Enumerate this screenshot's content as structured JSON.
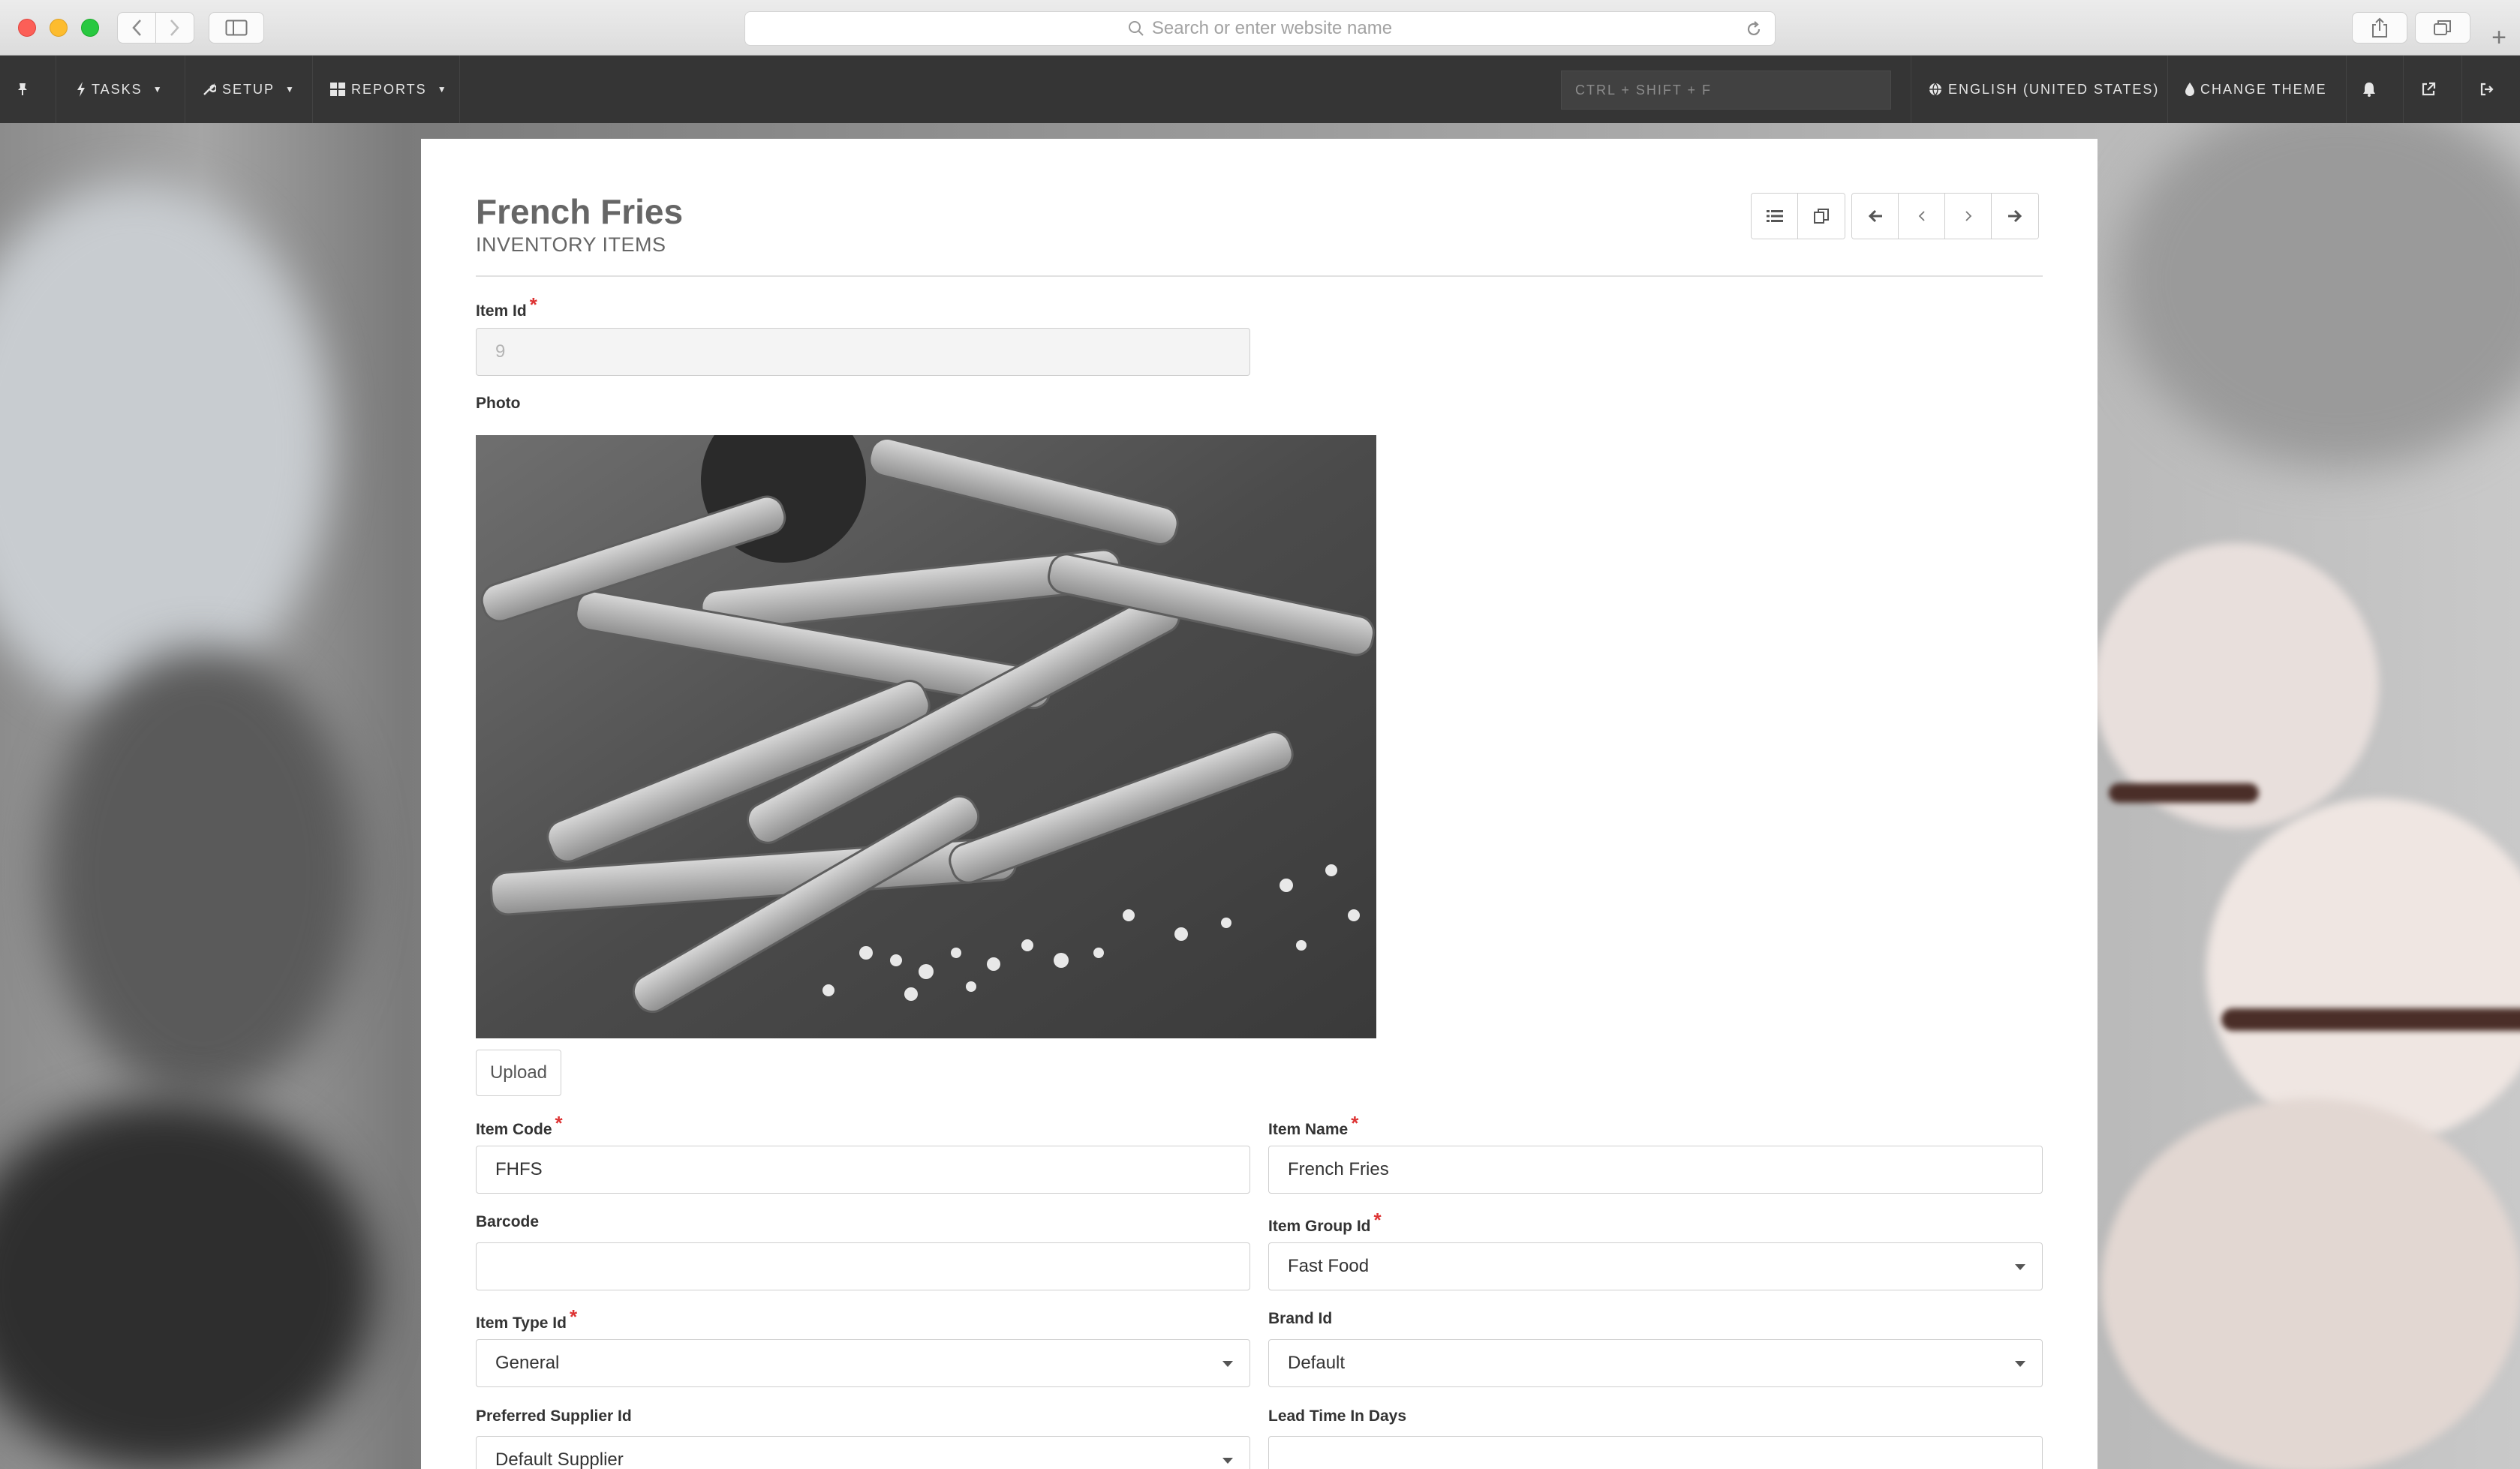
{
  "browser": {
    "address_placeholder": "Search or enter website name",
    "icons": [
      "back-icon",
      "forward-icon",
      "sidebar-icon",
      "search-icon",
      "reload-icon",
      "share-icon",
      "tabs-icon",
      "plus-icon"
    ]
  },
  "navbar": {
    "pin_icon": "pin-icon",
    "tasks": "TASKS",
    "setup": "SETUP",
    "reports": "REPORTS",
    "search_placeholder": "CTRL + SHIFT + F",
    "language": "ENGLISH (UNITED STATES)",
    "change_theme": "CHANGE THEME",
    "icons": [
      "bolt-icon",
      "wrench-icon",
      "grid-icon",
      "globe-icon",
      "droplet-icon",
      "bell-icon",
      "external-link-icon",
      "sign-out-icon"
    ]
  },
  "page": {
    "title": "French Fries",
    "subtitle": "INVENTORY ITEMS",
    "toolbar_icons": [
      "list-icon",
      "copy-icon",
      "arrow-left-icon",
      "chevron-left-icon",
      "chevron-right-icon",
      "arrow-right-icon"
    ]
  },
  "form": {
    "item_id": {
      "label": "Item Id",
      "required": "*",
      "value": "9"
    },
    "photo": {
      "label": "Photo",
      "upload_label": "Upload"
    },
    "item_code": {
      "label": "Item Code",
      "required": "*",
      "value": "FHFS"
    },
    "item_name": {
      "label": "Item Name",
      "required": "*",
      "value": "French Fries"
    },
    "barcode": {
      "label": "Barcode",
      "value": ""
    },
    "item_group_id": {
      "label": "Item Group Id",
      "required": "*",
      "value": "Fast Food"
    },
    "item_type_id": {
      "label": "Item Type Id",
      "required": "*",
      "value": "General"
    },
    "brand_id": {
      "label": "Brand Id",
      "value": "Default"
    },
    "preferred_supplier_id": {
      "label": "Preferred Supplier Id",
      "value": "Default Supplier"
    },
    "lead_time_in_days": {
      "label": "Lead Time In Days",
      "value": ""
    }
  },
  "colors": {
    "navbar_bg": "#353535",
    "required": "#dd3333",
    "panel_bg": "#ffffff"
  }
}
